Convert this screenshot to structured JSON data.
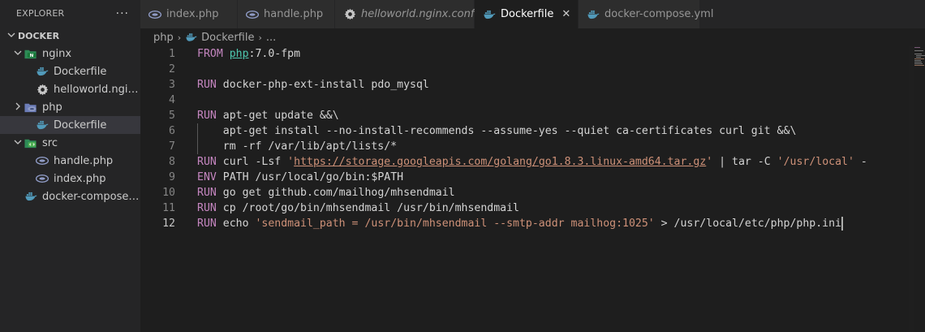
{
  "explorer": {
    "title": "EXPLORER",
    "more": "···",
    "root": "DOCKER",
    "tree": [
      {
        "label": "nginx",
        "type": "folder",
        "depth": 1,
        "icon": "nginx-folder-icon"
      },
      {
        "label": "Dockerfile",
        "type": "file",
        "depth": 2,
        "icon": "docker-icon"
      },
      {
        "label": "helloworld.nginx.conf",
        "type": "file",
        "depth": 2,
        "icon": "gear-icon"
      },
      {
        "label": "php",
        "type": "folder",
        "depth": 1,
        "icon": "php-folder-icon"
      },
      {
        "label": "Dockerfile",
        "type": "file",
        "depth": 2,
        "icon": "docker-icon",
        "selected": true
      },
      {
        "label": "src",
        "type": "folder",
        "depth": 1,
        "icon": "src-folder-icon"
      },
      {
        "label": "handle.php",
        "type": "file",
        "depth": 2,
        "icon": "php-file-icon"
      },
      {
        "label": "index.php",
        "type": "file",
        "depth": 2,
        "icon": "php-file-icon"
      },
      {
        "label": "docker-compose.yml",
        "type": "file",
        "depth": 1,
        "icon": "docker-icon"
      }
    ]
  },
  "tabs": [
    {
      "label": "index.php",
      "icon": "php-file-icon",
      "active": false,
      "italic": false
    },
    {
      "label": "handle.php",
      "icon": "php-file-icon",
      "active": false,
      "italic": false
    },
    {
      "label": "helloworld.nginx.conf",
      "icon": "gear-icon",
      "active": false,
      "italic": true
    },
    {
      "label": "Dockerfile",
      "icon": "docker-icon",
      "active": true,
      "italic": false,
      "close": "✕"
    },
    {
      "label": "docker-compose.yml",
      "icon": "docker-icon",
      "active": false,
      "italic": false
    }
  ],
  "breadcrumb": {
    "folder": "php",
    "file": "Dockerfile",
    "more": "...",
    "sep": "›"
  },
  "editor": {
    "current_line": 12,
    "lines": [
      {
        "n": "1",
        "tokens": [
          {
            "t": "FROM",
            "c": "kw"
          },
          {
            "t": " ",
            "c": "tx"
          },
          {
            "t": "php",
            "c": "img"
          },
          {
            "t": ":7.0-fpm",
            "c": "tx"
          }
        ]
      },
      {
        "n": "2",
        "tokens": []
      },
      {
        "n": "3",
        "tokens": [
          {
            "t": "RUN",
            "c": "kw"
          },
          {
            "t": " docker-php-ext-install pdo_mysql",
            "c": "tx"
          }
        ]
      },
      {
        "n": "4",
        "tokens": []
      },
      {
        "n": "5",
        "tokens": [
          {
            "t": "RUN",
            "c": "kw"
          },
          {
            "t": " apt-get update &&\\",
            "c": "tx"
          }
        ]
      },
      {
        "n": "6",
        "tokens": [
          {
            "t": "    apt-get install --no-install-recommends --assume-yes --quiet ca-certificates curl git &&\\",
            "c": "tx"
          }
        ]
      },
      {
        "n": "7",
        "tokens": [
          {
            "t": "    rm -rf /var/lib/apt/lists/*",
            "c": "tx"
          }
        ]
      },
      {
        "n": "8",
        "tokens": [
          {
            "t": "RUN",
            "c": "kw"
          },
          {
            "t": " curl -Lsf ",
            "c": "tx"
          },
          {
            "t": "'",
            "c": "str"
          },
          {
            "t": "https://storage.googleapis.com/golang/go1.8.3.linux-amd64.tar.gz",
            "c": "str lnk"
          },
          {
            "t": "'",
            "c": "str"
          },
          {
            "t": " | tar -C ",
            "c": "tx"
          },
          {
            "t": "'/usr/local'",
            "c": "str"
          },
          {
            "t": " -",
            "c": "tx"
          }
        ]
      },
      {
        "n": "9",
        "tokens": [
          {
            "t": "ENV",
            "c": "kw"
          },
          {
            "t": " PATH /usr/local/go/bin:$PATH",
            "c": "tx"
          }
        ]
      },
      {
        "n": "10",
        "tokens": [
          {
            "t": "RUN",
            "c": "kw"
          },
          {
            "t": " go get github.com/mailhog/mhsendmail",
            "c": "tx"
          }
        ]
      },
      {
        "n": "11",
        "tokens": [
          {
            "t": "RUN",
            "c": "kw"
          },
          {
            "t": " cp /root/go/bin/mhsendmail /usr/bin/mhsendmail",
            "c": "tx"
          }
        ]
      },
      {
        "n": "12",
        "tokens": [
          {
            "t": "RUN",
            "c": "kw"
          },
          {
            "t": " echo ",
            "c": "tx"
          },
          {
            "t": "'sendmail_path = /usr/bin/mhsendmail --smtp-addr mailhog:1025'",
            "c": "str"
          },
          {
            "t": " > /usr/local/etc/php/php.ini",
            "c": "tx"
          }
        ]
      }
    ]
  }
}
